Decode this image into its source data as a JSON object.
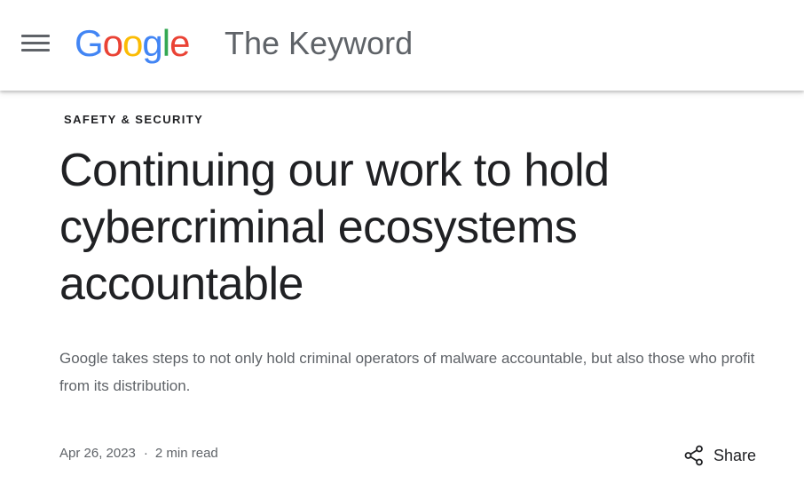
{
  "header": {
    "logo_letters": [
      {
        "char": "G",
        "color": "#4285F4"
      },
      {
        "char": "o",
        "color": "#EA4335"
      },
      {
        "char": "o",
        "color": "#FBBC05"
      },
      {
        "char": "g",
        "color": "#4285F4"
      },
      {
        "char": "l",
        "color": "#34A853"
      },
      {
        "char": "e",
        "color": "#EA4335"
      }
    ],
    "site_name": "The Keyword",
    "menu_icon": "hamburger-menu-icon"
  },
  "article": {
    "category": "SAFETY & SECURITY",
    "title": "Continuing our work to hold cybercriminal ecosystems accountable",
    "summary": "Google takes steps to not only hold criminal operators of malware accountable, but also those who profit from its distribution.",
    "date": "Apr 26, 2023",
    "separator": "·",
    "read_time": "2 min read",
    "share_label": "Share",
    "share_icon": "share-icon"
  }
}
